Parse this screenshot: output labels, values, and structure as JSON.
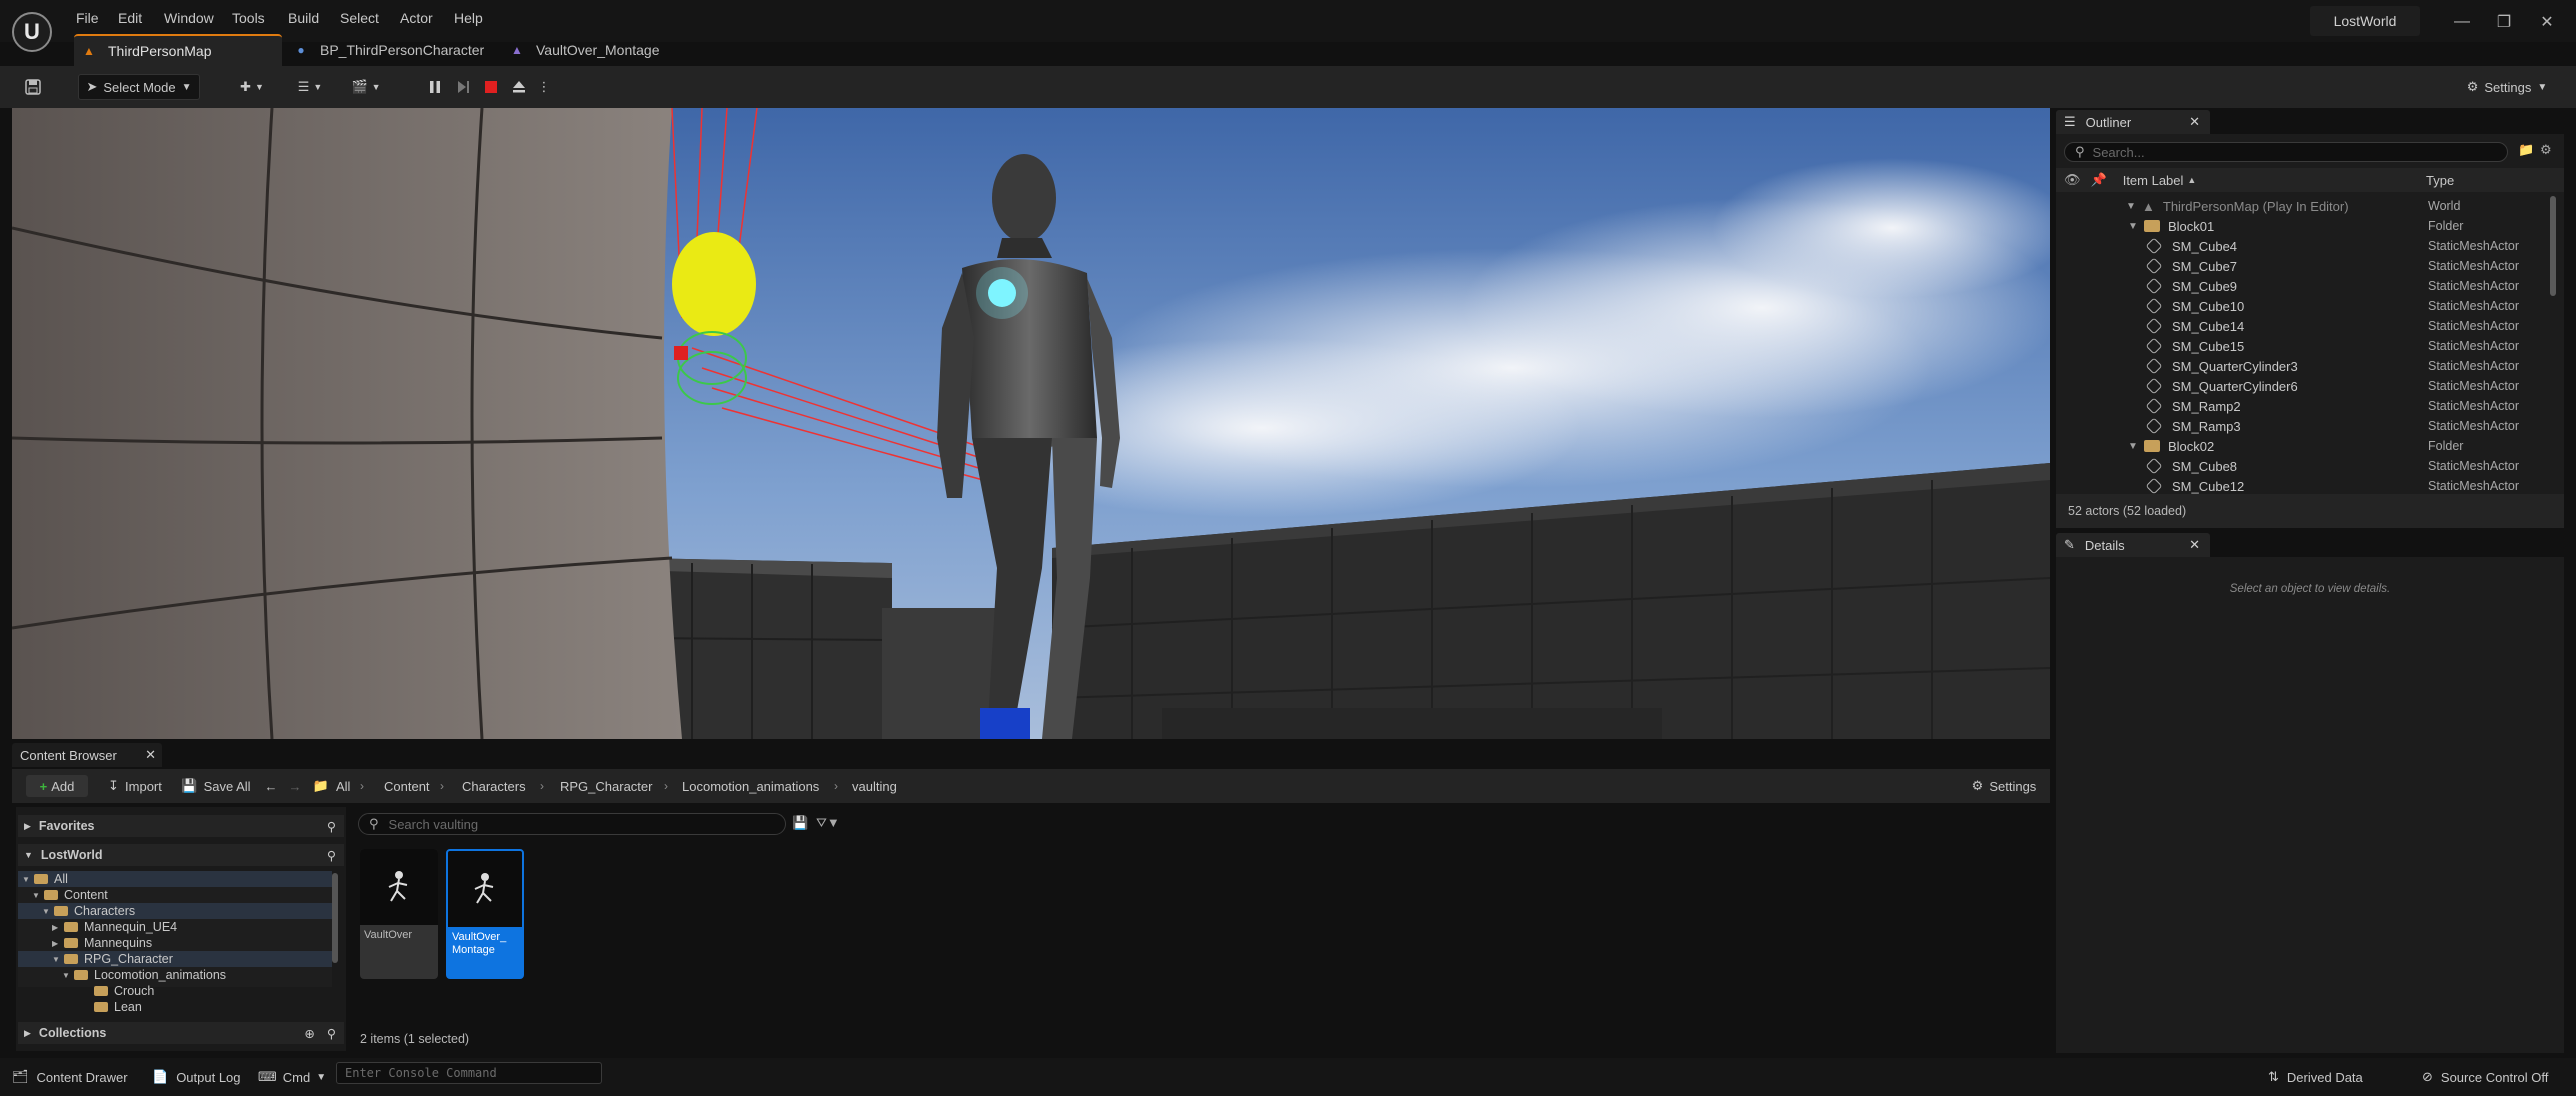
{
  "app": {
    "logo": "U",
    "project_name": "LostWorld",
    "menu": [
      "File",
      "Edit",
      "Window",
      "Tools",
      "Build",
      "Select",
      "Actor",
      "Help"
    ],
    "window_controls": [
      "minimize-icon",
      "restore-icon",
      "close-icon"
    ]
  },
  "tabs": [
    {
      "label": "ThirdPersonMap",
      "icon": "level-icon",
      "active": true
    },
    {
      "label": "BP_ThirdPersonCharacter",
      "icon": "blueprint-icon",
      "active": false
    },
    {
      "label": "VaultOver_Montage",
      "icon": "montage-icon",
      "active": false
    }
  ],
  "toolbar": {
    "select_mode": "Select Mode",
    "settings": "Settings",
    "play_controls": [
      "pause-icon",
      "step-icon",
      "stop-icon",
      "eject-icon",
      "more-icon"
    ]
  },
  "outliner": {
    "title": "Outliner",
    "search_placeholder": "Search...",
    "col_label": "Item Label",
    "col_type": "Type",
    "rows": [
      {
        "label": "ThirdPersonMap (Play In Editor)",
        "type": "World",
        "kind": "world"
      },
      {
        "label": "Block01",
        "type": "Folder",
        "kind": "folder"
      },
      {
        "label": "SM_Cube4",
        "type": "StaticMeshActor",
        "kind": "mesh"
      },
      {
        "label": "SM_Cube7",
        "type": "StaticMeshActor",
        "kind": "mesh"
      },
      {
        "label": "SM_Cube9",
        "type": "StaticMeshActor",
        "kind": "mesh"
      },
      {
        "label": "SM_Cube10",
        "type": "StaticMeshActor",
        "kind": "mesh"
      },
      {
        "label": "SM_Cube14",
        "type": "StaticMeshActor",
        "kind": "mesh"
      },
      {
        "label": "SM_Cube15",
        "type": "StaticMeshActor",
        "kind": "mesh"
      },
      {
        "label": "SM_QuarterCylinder3",
        "type": "StaticMeshActor",
        "kind": "mesh"
      },
      {
        "label": "SM_QuarterCylinder6",
        "type": "StaticMeshActor",
        "kind": "mesh"
      },
      {
        "label": "SM_Ramp2",
        "type": "StaticMeshActor",
        "kind": "mesh"
      },
      {
        "label": "SM_Ramp3",
        "type": "StaticMeshActor",
        "kind": "mesh"
      },
      {
        "label": "Block02",
        "type": "Folder",
        "kind": "folder"
      },
      {
        "label": "SM_Cube8",
        "type": "StaticMeshActor",
        "kind": "mesh"
      },
      {
        "label": "SM_Cube12",
        "type": "StaticMeshActor",
        "kind": "mesh"
      }
    ],
    "footer": "52 actors (52 loaded)"
  },
  "details": {
    "title": "Details",
    "empty_text": "Select an object to view details."
  },
  "content_browser": {
    "title": "Content Browser",
    "add": "Add",
    "import": "Import",
    "save_all": "Save All",
    "settings": "Settings",
    "breadcrumb": [
      "All",
      "Content",
      "Characters",
      "RPG_Character",
      "Locomotion_animations",
      "vaulting"
    ],
    "search_placeholder": "Search vaulting",
    "sections": {
      "favorites": "Favorites",
      "project": "LostWorld",
      "collections": "Collections"
    },
    "tree": [
      {
        "label": "All"
      },
      {
        "label": "Content"
      },
      {
        "label": "Characters"
      },
      {
        "label": "Mannequin_UE4"
      },
      {
        "label": "Mannequins"
      },
      {
        "label": "RPG_Character"
      },
      {
        "label": "Locomotion_animations"
      },
      {
        "label": "Crouch"
      },
      {
        "label": "Lean"
      }
    ],
    "assets": [
      {
        "label": "VaultOver",
        "selected": false
      },
      {
        "label": "VaultOver_ Montage",
        "selected": true
      }
    ],
    "status": "2 items (1 selected)"
  },
  "statusbar": {
    "content_drawer": "Content Drawer",
    "output_log": "Output Log",
    "cmd": "Cmd",
    "console_placeholder": "Enter Console Command",
    "derived_data": "Derived Data",
    "source_control": "Source Control Off"
  },
  "colors": {
    "accent": "#e07b10",
    "selection": "#0e74e0",
    "stop_red": "#e02020",
    "add_green": "#3db63d"
  }
}
